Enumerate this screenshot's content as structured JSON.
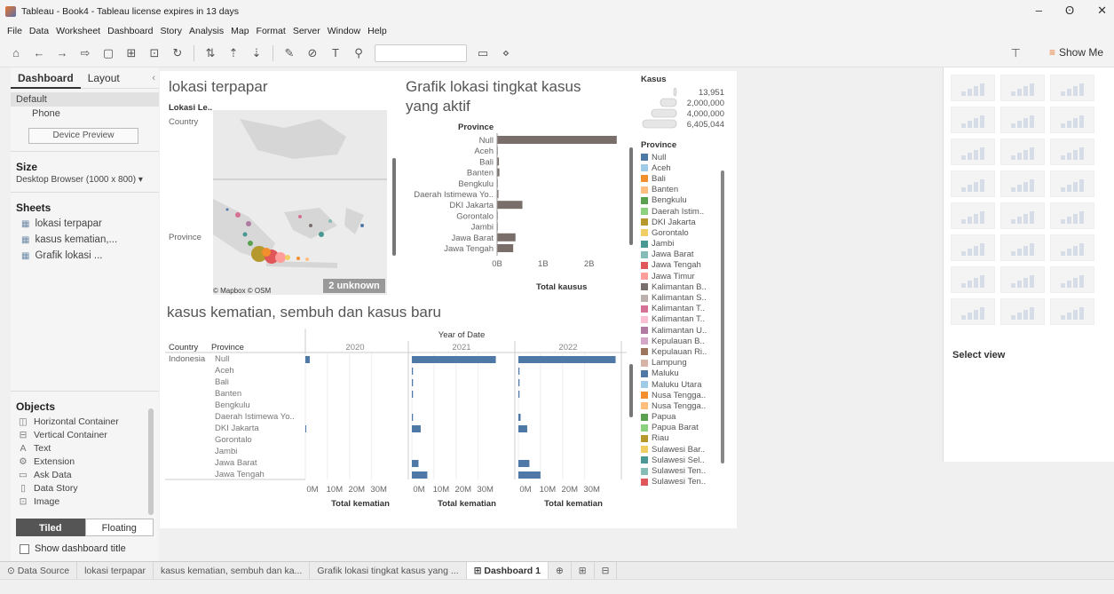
{
  "window": {
    "title": "Tableau - Book4 - Tableau license expires in 13 days",
    "minimize": "–",
    "maximize": "ʘ",
    "close": "✕"
  },
  "menu": [
    "File",
    "Data",
    "Worksheet",
    "Dashboard",
    "Story",
    "Analysis",
    "Map",
    "Format",
    "Server",
    "Window",
    "Help"
  ],
  "toolbar": {
    "show_me": "Show Me"
  },
  "left_panel": {
    "tabs": [
      "Dashboard",
      "Layout"
    ],
    "devices": [
      "Default",
      "Phone"
    ],
    "device_preview": "Device Preview",
    "size_heading": "Size",
    "size_value": "Desktop Browser (1000 x 800) ▾",
    "sheets_heading": "Sheets",
    "sheets": [
      "lokasi terpapar",
      "kasus kematian,...",
      "Grafik lokasi ..."
    ],
    "objects_heading": "Objects",
    "objects": [
      {
        "icon": "◫",
        "label": "Horizontal Container"
      },
      {
        "icon": "⊟",
        "label": "Vertical Container"
      },
      {
        "icon": "A",
        "label": "Text"
      },
      {
        "icon": "⚙",
        "label": "Extension"
      },
      {
        "icon": "▭",
        "label": "Ask Data"
      },
      {
        "icon": "▯",
        "label": "Data Story"
      },
      {
        "icon": "⊡",
        "label": "Image"
      }
    ],
    "tiled": "Tiled",
    "floating": "Floating",
    "show_title": "Show dashboard title"
  },
  "map": {
    "title": "lokasi terpapar",
    "col_header": "Lokasi Le..",
    "row1": "Country",
    "row2": "Province",
    "credit": "© Mapbox © OSM",
    "unknown": "2 unknown"
  },
  "bar_chart": {
    "title_line1": "Grafik lokasi tingkat kasus",
    "title_line2": "yang aktif",
    "header": "Province",
    "axis_title": "Total kausus",
    "ticks": [
      "0B",
      "1B",
      "2B"
    ]
  },
  "small_multiples": {
    "title": "kasus kematian, sembuh dan kasus baru",
    "year_header": "Year of Date",
    "years": [
      "2020",
      "2021",
      "2022"
    ],
    "country_header": "Country",
    "province_header": "Province",
    "country_value": "Indonesia",
    "axis_ticks": [
      "0M",
      "10M",
      "20M",
      "30M"
    ],
    "axis_title": "Total kematian"
  },
  "legend": {
    "size_title": "Kasus",
    "size_values": [
      "13,951",
      "2,000,000",
      "4,000,000",
      "6,405,044"
    ],
    "color_title": "Province",
    "items": [
      {
        "label": "Null",
        "color": "#4e79a7"
      },
      {
        "label": "Aceh",
        "color": "#a0cbe8"
      },
      {
        "label": "Bali",
        "color": "#f28e2b"
      },
      {
        "label": "Banten",
        "color": "#ffbe7d"
      },
      {
        "label": "Bengkulu",
        "color": "#59a14f"
      },
      {
        "label": "Daerah Istim..",
        "color": "#8cd17d"
      },
      {
        "label": "DKI Jakarta",
        "color": "#b6992d"
      },
      {
        "label": "Gorontalo",
        "color": "#f1ce63"
      },
      {
        "label": "Jambi",
        "color": "#499894"
      },
      {
        "label": "Jawa Barat",
        "color": "#86bcb6"
      },
      {
        "label": "Jawa Tengah",
        "color": "#e15759"
      },
      {
        "label": "Jawa Timur",
        "color": "#ff9d9a"
      },
      {
        "label": "Kalimantan B..",
        "color": "#79706e"
      },
      {
        "label": "Kalimantan S..",
        "color": "#bab0ac"
      },
      {
        "label": "Kalimantan T..",
        "color": "#d37295"
      },
      {
        "label": "Kalimantan T..",
        "color": "#fabfd2"
      },
      {
        "label": "Kalimantan U..",
        "color": "#b07aa1"
      },
      {
        "label": "Kepulauan B..",
        "color": "#d4a6c8"
      },
      {
        "label": "Kepulauan Ri..",
        "color": "#9d7660"
      },
      {
        "label": "Lampung",
        "color": "#d7b5a6"
      },
      {
        "label": "Maluku",
        "color": "#4e79a7"
      },
      {
        "label": "Maluku Utara",
        "color": "#a0cbe8"
      },
      {
        "label": "Nusa Tengga..",
        "color": "#f28e2b"
      },
      {
        "label": "Nusa Tengga..",
        "color": "#ffbe7d"
      },
      {
        "label": "Papua",
        "color": "#59a14f"
      },
      {
        "label": "Papua Barat",
        "color": "#8cd17d"
      },
      {
        "label": "Riau",
        "color": "#b6992d"
      },
      {
        "label": "Sulawesi Bar..",
        "color": "#f1ce63"
      },
      {
        "label": "Sulawesi Sel..",
        "color": "#499894"
      },
      {
        "label": "Sulawesi Ten..",
        "color": "#86bcb6"
      },
      {
        "label": "Sulawesi Ten..",
        "color": "#e15759"
      }
    ]
  },
  "show_me": {
    "select_view": "Select view"
  },
  "bottom_tabs": [
    "Data Source",
    "lokasi terpapar",
    "kasus kematian, sembuh dan ka...",
    "Grafik lokasi tingkat kasus yang ...",
    "Dashboard 1"
  ],
  "colors": {
    "bar_brown": "#7a6e6a",
    "bar_blue": "#4e79a7"
  },
  "chart_data": [
    {
      "type": "bar",
      "title": "Grafik lokasi tingkat kasus yang aktif",
      "xlabel": "Total kausus",
      "ylabel": "Province",
      "categories": [
        "Null",
        "Aceh",
        "Bali",
        "Banten",
        "Bengkulu",
        "Daerah Istimewa Yo..",
        "DKI Jakarta",
        "Gorontalo",
        "Jambi",
        "Jawa Barat",
        "Jawa Tengah"
      ],
      "values": [
        2.6,
        0.01,
        0.04,
        0.05,
        0.0,
        0.03,
        0.55,
        0.0,
        0.01,
        0.4,
        0.35
      ],
      "xlim": [
        0,
        2.7
      ],
      "x_ticks": [
        "0B",
        "1B",
        "2B"
      ]
    },
    {
      "type": "bar",
      "title": "kasus kematian, sembuh dan kasus baru",
      "xlabel": "Total kematian",
      "categories": [
        "Null",
        "Aceh",
        "Bali",
        "Banten",
        "Bengkulu",
        "Daerah Istimewa Yo..",
        "DKI Jakarta",
        "Gorontalo",
        "Jambi",
        "Jawa Barat",
        "Jawa Tengah"
      ],
      "series": [
        {
          "name": "2020",
          "values": [
            2.0,
            0,
            0,
            0,
            0,
            0,
            0.3,
            0,
            0,
            0,
            0
          ]
        },
        {
          "name": "2021",
          "values": [
            38,
            0.5,
            0.5,
            0.5,
            0,
            0.5,
            4,
            0,
            0,
            3,
            7
          ]
        },
        {
          "name": "2022",
          "values": [
            44,
            0.5,
            0.5,
            0.5,
            0,
            1,
            4,
            0,
            0,
            5,
            10
          ]
        }
      ],
      "xlim": [
        0,
        45
      ],
      "x_ticks": [
        "0M",
        "10M",
        "20M",
        "30M"
      ]
    }
  ]
}
